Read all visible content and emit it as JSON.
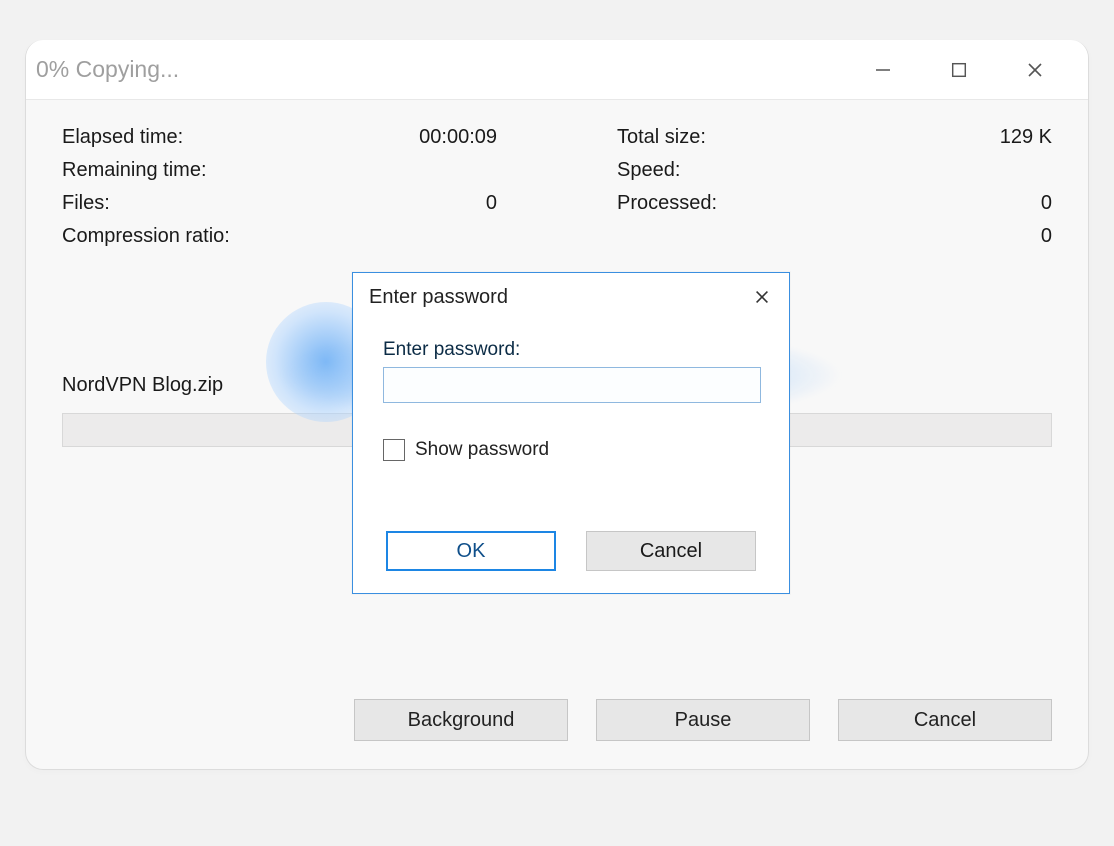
{
  "title": "0% Copying...",
  "stats": {
    "left": {
      "elapsed_label": "Elapsed time:",
      "elapsed_value": "00:00:09",
      "remaining_label": "Remaining time:",
      "remaining_value": "",
      "files_label": "Files:",
      "files_value": "0",
      "compression_label": "Compression ratio:",
      "compression_value": ""
    },
    "right": {
      "total_size_label": "Total size:",
      "total_size_value": "129 K",
      "speed_label": "Speed:",
      "speed_value": "",
      "processed_label": "Processed:",
      "processed_value": "0",
      "packed_label": "",
      "packed_value": "0"
    }
  },
  "filename": "NordVPN Blog.zip",
  "buttons": {
    "background": "Background",
    "pause": "Pause",
    "cancel": "Cancel"
  },
  "dialog": {
    "title": "Enter password",
    "field_label": "Enter password:",
    "input_value": "",
    "show_password_label": "Show password",
    "ok_label": "OK",
    "cancel_label": "Cancel"
  }
}
